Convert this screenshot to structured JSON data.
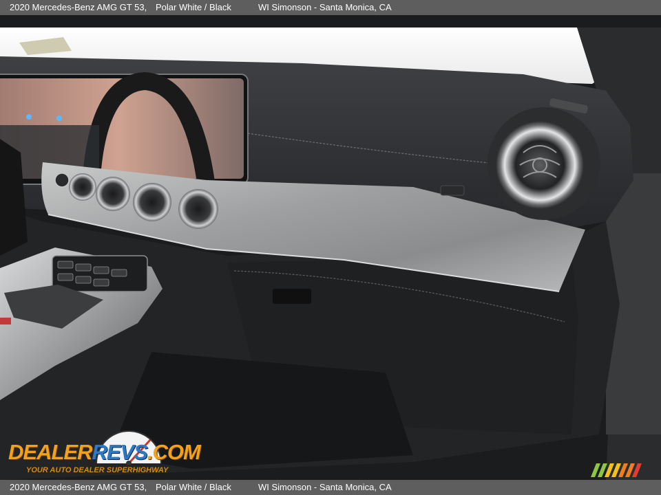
{
  "caption_top": {
    "model": "2020 Mercedes-Benz AMG GT 53,",
    "color": "Polar White / Black",
    "dealer": "WI Simonson - Santa Monica, CA"
  },
  "caption_bottom": {
    "model": "2020 Mercedes-Benz AMG GT 53,",
    "color": "Polar White / Black",
    "dealer": "WI Simonson - Santa Monica, CA"
  },
  "photo": {
    "subject": "dashboard-passenger-side",
    "colors": {
      "dash_leather": "#2f3032",
      "trim_silver": "#b4b5b6",
      "screen_glow": "#c99a8a",
      "background": "#1c1d1f"
    }
  },
  "watermark": {
    "logo_part1": "DEALER",
    "logo_part2": "REVS",
    "logo_part3": ".COM",
    "tagline": "YOUR AUTO DEALER SUPERHIGHWAY",
    "colors": {
      "orange": "#f2a11b",
      "blue": "#2f78c4"
    }
  },
  "brand_stripes": {
    "colors": [
      "#8dc63f",
      "#f2c21b",
      "#ef7d22",
      "#e63b2e"
    ]
  }
}
